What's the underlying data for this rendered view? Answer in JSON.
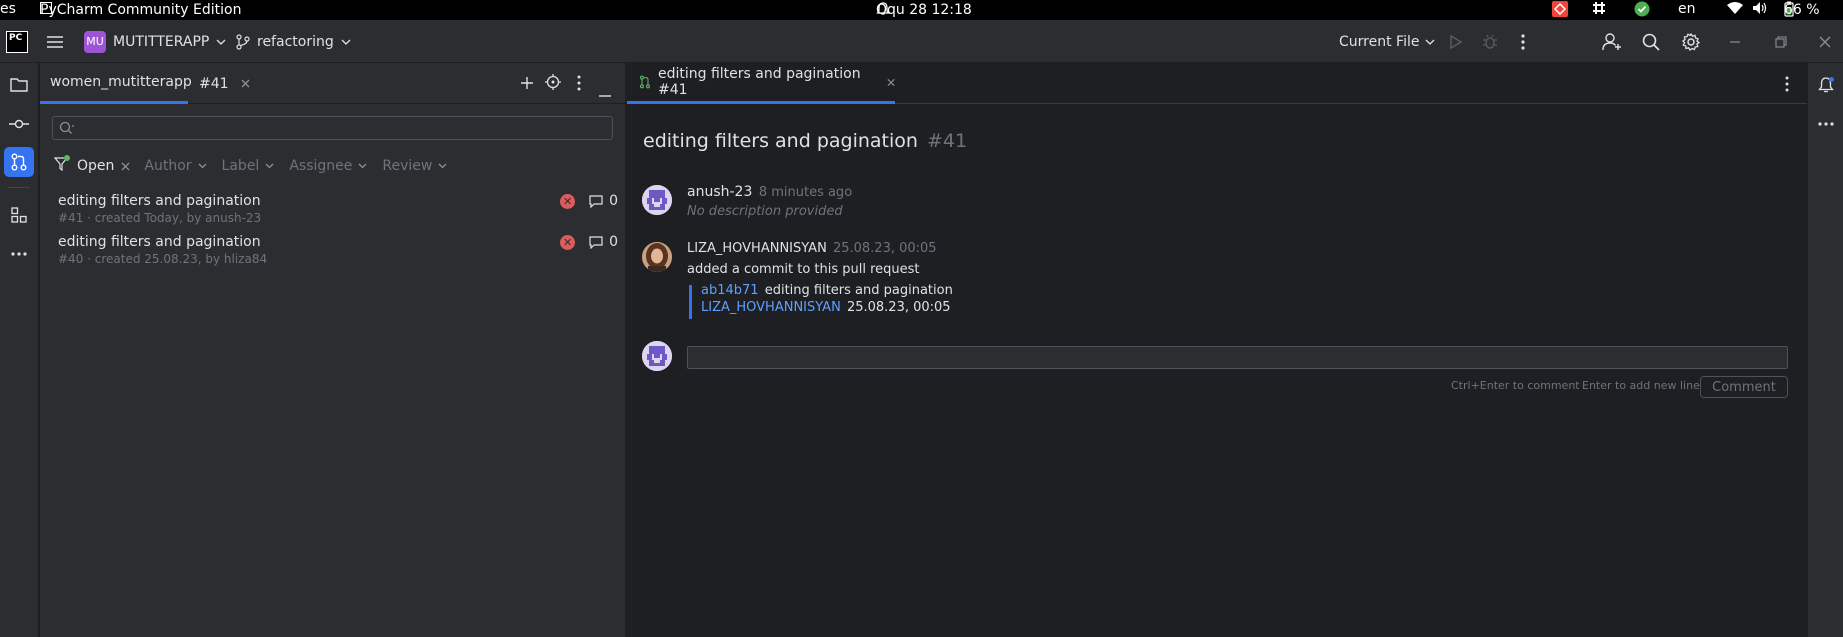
{
  "system_bar": {
    "left_fragment": "es",
    "app_name": "PyCharm Community Edition",
    "datetime": "Oqu 28  12:18",
    "language": "en",
    "battery": "66 %"
  },
  "titlebar": {
    "logo": "PC",
    "project_badge": "MU",
    "project_name": "MUTITTERAPP",
    "branch": "refactoring",
    "run_config": "Current File"
  },
  "left_panel": {
    "tabs": [
      "women_mutitterapp",
      "#41"
    ],
    "search_placeholder": "",
    "filters": {
      "state": "Open",
      "author": "Author",
      "label": "Label",
      "assignee": "Assignee",
      "review": "Review"
    },
    "pull_requests": [
      {
        "title": "editing filters and pagination",
        "subtitle": "#41 · created Today, by anush-23",
        "comments": "0"
      },
      {
        "title": "editing filters and pagination",
        "subtitle": "#40 · created 25.08.23, by hliza84",
        "comments": "0"
      }
    ]
  },
  "editor": {
    "tab_label": "editing filters and pagination #41",
    "pr_title": "editing filters and pagination",
    "pr_number": "#41",
    "author_entry": {
      "author": "anush-23",
      "time": "8 minutes ago",
      "description": "No description provided"
    },
    "commit_entry": {
      "author": "LIZA_HOVHANNISYAN",
      "time": "25.08.23, 00:05",
      "action": "added a commit to this pull request",
      "commit_hash": "ab14b71",
      "commit_message": "editing filters and pagination",
      "commit_author": "LIZA_HOVHANNISYAN",
      "commit_time": "25.08.23, 00:05"
    },
    "comment_box": {
      "value": "",
      "hint_ctrl_enter": "Ctrl+Enter to comment",
      "hint_enter": "Enter to add new line",
      "button_label": "Comment"
    }
  },
  "colors": {
    "accent": "#3574f0",
    "project_badge": "#9e54d6",
    "error": "#db5c5c",
    "link": "#5e9fff",
    "commit_bar": "#3574f0"
  }
}
